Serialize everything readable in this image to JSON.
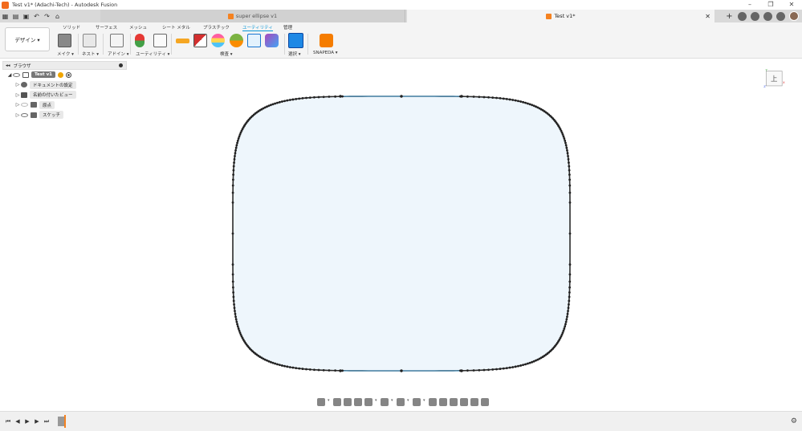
{
  "window": {
    "title": "Test v1* (Adachi-Tech) - Autodesk Fusion",
    "controls": [
      "–",
      "❐",
      "✕"
    ]
  },
  "tabs": {
    "inactive": "super ellipse v1",
    "active": "Test v1*",
    "close_glyph": "✕",
    "new_tab_glyph": "+"
  },
  "toolbar": {
    "workspace_label": "デザイン ▾",
    "ribbon_tabs": [
      "ソリッド",
      "サーフェス",
      "メッシュ",
      "シート メタル",
      "プラスチック",
      "ユーティリティ",
      "管理"
    ],
    "active_tab_index": 5,
    "groups": [
      {
        "label": "メイク ▾"
      },
      {
        "label": "ネスト ▾"
      },
      {
        "label": "アドイン ▾"
      },
      {
        "label": "ユーティリティ ▾"
      },
      {
        "label": "検査 ▾"
      },
      {
        "label": "選択 ▾"
      },
      {
        "label": "SNAPEDA ▾"
      }
    ]
  },
  "browser": {
    "title": "ブラウザ",
    "items": [
      {
        "label": "Test v1"
      },
      {
        "label": "ドキュメントの設定"
      },
      {
        "label": "名前の付いたビュー"
      },
      {
        "label": "原点"
      },
      {
        "label": "スケッチ"
      }
    ]
  },
  "viewcube": {
    "face": "上",
    "axes": {
      "x": "X",
      "y": "Y",
      "z": "Z"
    },
    "colors": {
      "x": "#e03030",
      "y": "#30a030",
      "z": "#3050e0"
    }
  },
  "sketch": {
    "shape": "superellipse",
    "fill": "#eef6fc",
    "stroke": "#2b2b2b",
    "segment_color": "#4aa3d8",
    "point_color": "#222222"
  },
  "timeline": {
    "controls": [
      "⏮",
      "◀",
      "▶",
      "▶",
      "⏭"
    ],
    "settings_glyph": "⚙"
  }
}
